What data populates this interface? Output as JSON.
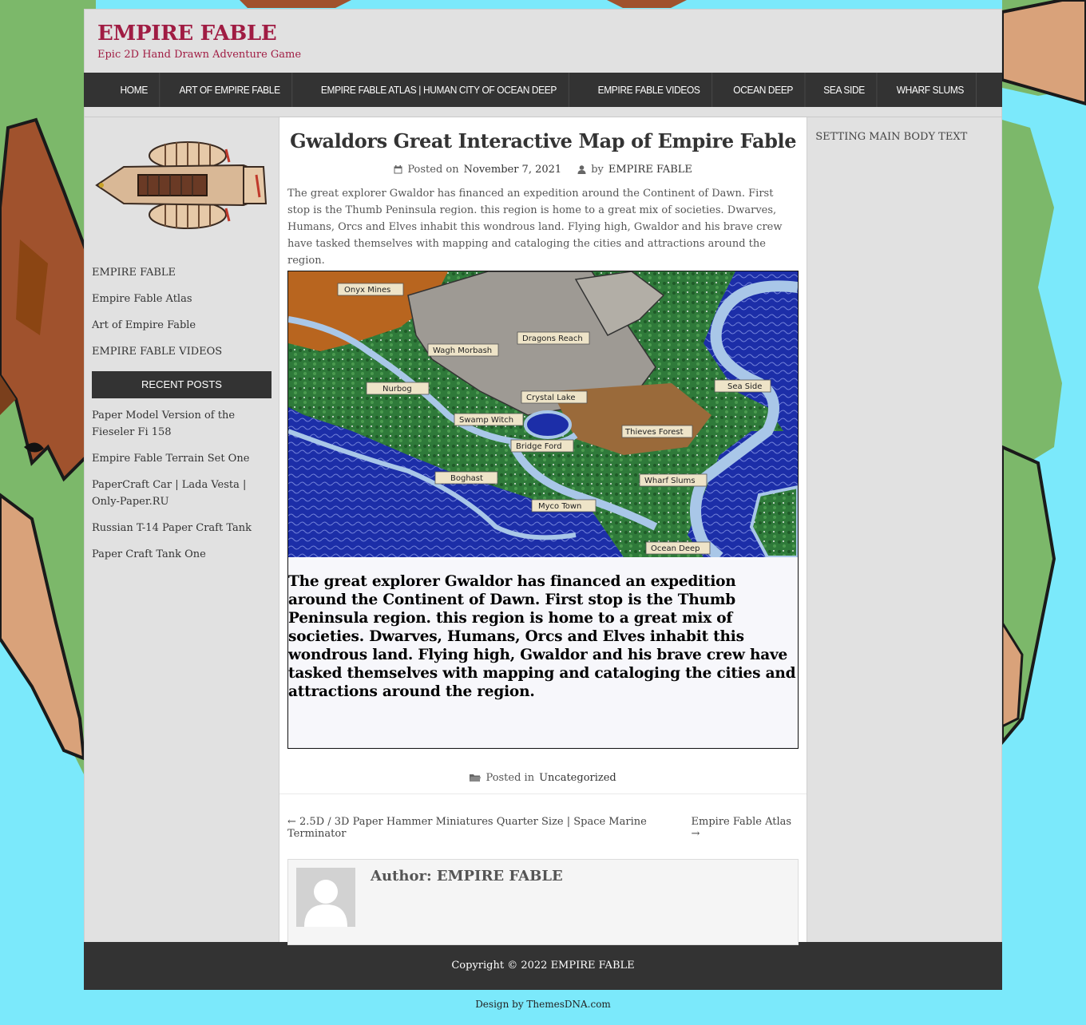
{
  "site": {
    "title": "EMPIRE FABLE",
    "tagline": "Epic 2D Hand Drawn Adventure Game"
  },
  "nav": {
    "items": [
      "HOME",
      "ART OF EMPIRE FABLE",
      "EMPIRE FABLE ATLAS | HUMAN CITY OF OCEAN DEEP",
      "EMPIRE FABLE VIDEOS",
      "OCEAN DEEP",
      "SEA SIDE",
      "WHARF SLUMS"
    ]
  },
  "left_sidebar": {
    "links": [
      "EMPIRE FABLE",
      "Empire Fable Atlas",
      "Art of Empire Fable",
      "EMPIRE FABLE VIDEOS"
    ],
    "recent_title": "RECENT POSTS",
    "recent_posts": [
      "Paper Model Version of the Fieseler Fi 158",
      "Empire Fable Terrain Set One",
      "PaperCraft Car | Lada Vesta | Only-Paper.RU",
      "Russian T-14 Paper Craft Tank",
      "Paper Craft Tank One"
    ]
  },
  "right_sidebar": {
    "text": "SETTING MAIN BODY TEXT"
  },
  "post": {
    "title": "Gwaldors Great Interactive Map of Empire Fable",
    "posted_on_label": "Posted on",
    "date": "November 7, 2021",
    "by_label": "by",
    "author": "EMPIRE FABLE",
    "intro": "The great explorer Gwaldor has financed an expedition around the Continent of Dawn. First stop is the Thumb Peninsula region. this region is home to a great mix of societies. Dwarves, Humans, Orcs and Elves inhabit this wondrous land. Flying high, Gwaldor and his brave crew have tasked themselves with mapping and cataloging the cities and attractions around the region.",
    "map_labels": [
      "Onyx Mines",
      "Dragons Reach",
      "Wagh Morbash",
      "Nurbog",
      "Crystal Lake",
      "Sea Side",
      "Swamp Witch",
      "Thieves Forest",
      "Bridge Ford",
      "Boghast",
      "Wharf Slums",
      "Myco Town",
      "Ocean Deep"
    ],
    "map_text": "The great explorer Gwaldor has financed an expedition around the Continent of Dawn. First stop is the Thumb Peninsula region. this region is home to a great mix of societies. Dwarves, Humans, Orcs and Elves inhabit this wondrous land. Flying high, Gwaldor and his brave crew have tasked themselves with mapping and cataloging the cities and attractions around the region.",
    "posted_in_label": "Posted in",
    "category": "Uncategorized",
    "prev_link": "← 2.5D / 3D Paper Hammer Miniatures Quarter Size | Space Marine Terminator",
    "next_link": "Empire Fable Atlas →",
    "author_box_label": "Author:",
    "author_box_name": "EMPIRE FABLE"
  },
  "footer": {
    "copyright": "Copyright © 2022 EMPIRE FABLE",
    "credit": "Design by ThemesDNA.com"
  },
  "colors": {
    "brand": "#a01c43",
    "nav_bg": "#333333",
    "page_bg": "#7be9fb"
  }
}
